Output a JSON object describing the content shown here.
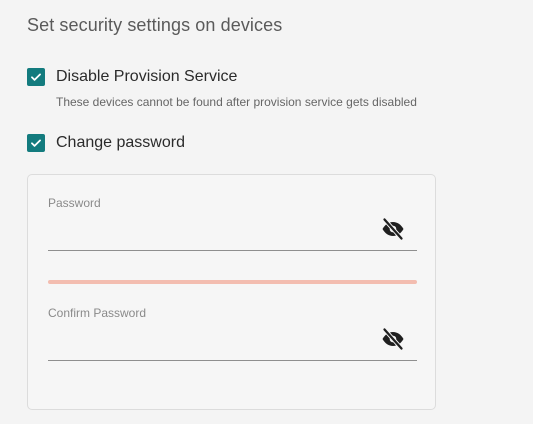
{
  "section": {
    "title": "Set security settings on devices"
  },
  "options": {
    "disable_provision": {
      "label": "Disable Provision Service",
      "checked": true,
      "hint": "These devices cannot be found after provision service gets disabled"
    },
    "change_password": {
      "label": "Change password",
      "checked": true
    }
  },
  "password_form": {
    "password": {
      "label": "Password",
      "value": "",
      "visibility_icon": "eye-off-icon"
    },
    "strength_color": "#f3bdb0",
    "confirm_password": {
      "label": "Confirm Password",
      "value": "",
      "visibility_icon": "eye-off-icon"
    }
  },
  "colors": {
    "checkbox_accent": "#137b7e",
    "background": "#f4f4f4"
  }
}
